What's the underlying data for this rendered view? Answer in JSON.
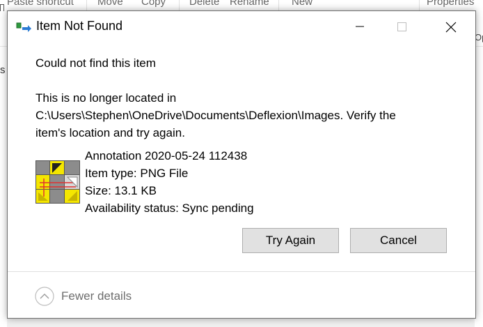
{
  "background_ribbon": {
    "items": [
      "Paste shortcut",
      "Move",
      "Copy",
      "Delete",
      "Rename",
      "New",
      "Properties"
    ],
    "left_fragment": "s",
    "right_fragment": "Op"
  },
  "dialog": {
    "title": "Item Not Found",
    "heading": "Could not find this item",
    "message_lines": [
      "This is no longer located in",
      "C:\\Users\\Stephen\\OneDrive\\Documents\\Deflexion\\Images. Verify the",
      "item's location and try again."
    ],
    "item": {
      "name": "Annotation 2020-05-24 112438",
      "type": "Item type: PNG File",
      "size": "Size: 13.1 KB",
      "availability": "Availability status: Sync pending"
    },
    "buttons": {
      "try_again": "Try Again",
      "cancel": "Cancel"
    },
    "details_toggle": "Fewer details"
  },
  "colors": {
    "dialog_bg": "#ffffff",
    "button_bg": "#e1e1e1",
    "button_border": "#adadad",
    "muted_text": "#6d6d6d"
  },
  "icons": {
    "title": "move-file-icon",
    "minimize": "minimize-icon",
    "maximize": "maximize-icon",
    "close": "close-icon",
    "details": "chevron-up-circle-icon"
  }
}
